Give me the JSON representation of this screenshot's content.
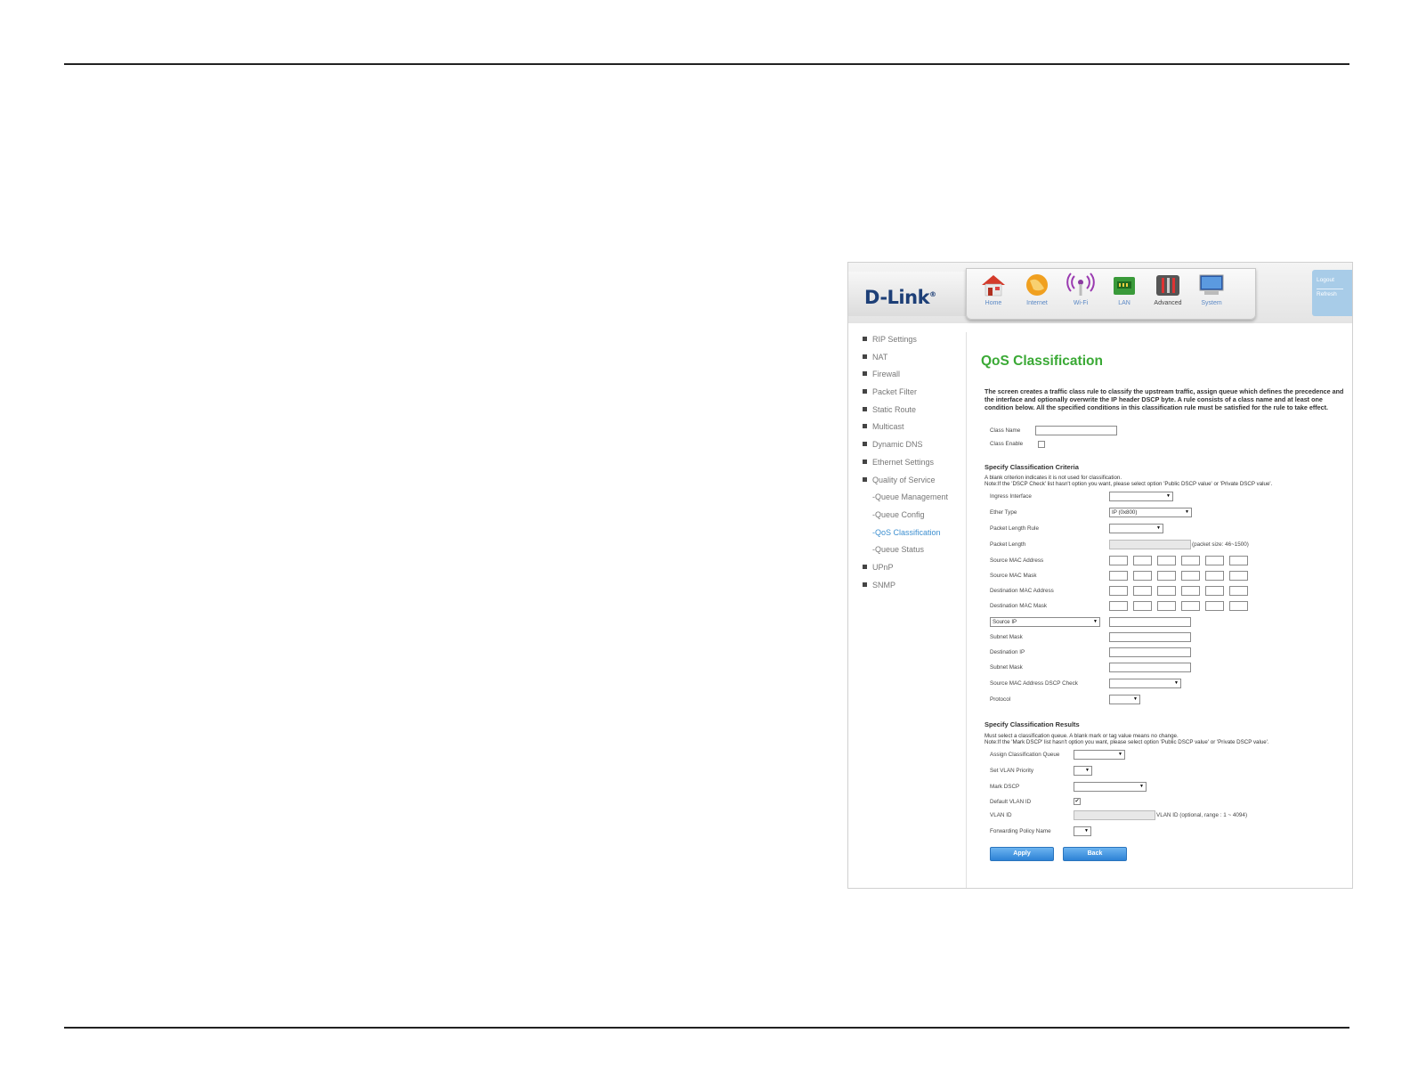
{
  "brand": {
    "logo": "D-Link",
    "logo_mark": "®"
  },
  "nav": [
    {
      "label": "Home",
      "icon": "home-icon"
    },
    {
      "label": "Internet",
      "icon": "globe-icon"
    },
    {
      "label": "Wi-Fi",
      "icon": "wifi-icon"
    },
    {
      "label": "LAN",
      "icon": "lan-icon"
    },
    {
      "label": "Advanced",
      "icon": "tools-icon"
    },
    {
      "label": "System",
      "icon": "monitor-icon"
    }
  ],
  "links": {
    "logout": "Logout",
    "refresh": "Refresh"
  },
  "menu": [
    {
      "label": "RIP Settings"
    },
    {
      "label": "NAT"
    },
    {
      "label": "Firewall"
    },
    {
      "label": "Packet Filter"
    },
    {
      "label": "Static Route"
    },
    {
      "label": "Multicast"
    },
    {
      "label": "Dynamic DNS"
    },
    {
      "label": "Ethernet Settings"
    },
    {
      "label": "Quality of Service"
    },
    {
      "label": "-Queue Management"
    },
    {
      "label": "-Queue Config"
    },
    {
      "label": "-QoS Classification"
    },
    {
      "label": "-Queue Status"
    },
    {
      "label": "UPnP"
    },
    {
      "label": "SNMP"
    }
  ],
  "page": {
    "title": "QoS Classification",
    "intro": "The screen creates a traffic class rule to classify the upstream traffic, assign queue which defines the precedence and the interface and optionally overwrite the IP header DSCP byte. A rule consists of a class name and at least one condition below. All the specified conditions in this classification rule must be satisfied for the rule to take effect."
  },
  "form": {
    "class_name": "Class Name",
    "class_enable": "Class Enable",
    "criteria_title": "Specify Classification Criteria",
    "criteria_note1": "A blank criterion indicates it is not used for classification.",
    "criteria_note2": "Note:If the 'DSCP Check' list hasn't option you want, please select option 'Public DSCP value' or 'Private DSCP value'.",
    "ingress": "Ingress Interface",
    "ether_type": "Ether Type",
    "ether_type_value": "IP (0x800)",
    "pkt_len_rule": "Packet Length Rule",
    "pkt_len": "Packet Length",
    "pkt_len_hint": "(packet size: 46~1500)",
    "src_mac": "Source MAC Address",
    "src_mac_mask": "Source MAC Mask",
    "dst_mac": "Destination MAC Address",
    "dst_mac_mask": "Destination MAC Mask",
    "src_ip_select": "Source IP",
    "subnet_mask1": "Subnet Mask",
    "dst_ip": "Destination IP",
    "subnet_mask2": "Subnet Mask",
    "dscp_check": "Source MAC Address DSCP Check",
    "protocol": "Protocol",
    "results_title": "Specify Classification Results",
    "results_note1": "Must select a classification queue. A blank mark or tag value means no change.",
    "results_note2": "Note:If the 'Mark DSCP' list hasn't option you want, please select option 'Public DSCP value' or 'Private DSCP value'.",
    "assign_queue": "Assign Classification Queue",
    "vlan_priority": "Set VLAN Priority",
    "mark_dscp": "Mark DSCP",
    "default_vlan": "Default VLAN ID",
    "default_vlan_mark": "✔",
    "vlan_id": "VLAN ID",
    "vlan_id_hint": "VLAN ID (optional, range : 1 ~ 4094)",
    "fwd_policy": "Forwarding Policy Name"
  },
  "buttons": {
    "apply": "Apply",
    "back": "Back"
  },
  "colors": {
    "title_green": "#3aa935",
    "link_blue": "#3d8fd0",
    "button_blue": "#2d82d6"
  }
}
